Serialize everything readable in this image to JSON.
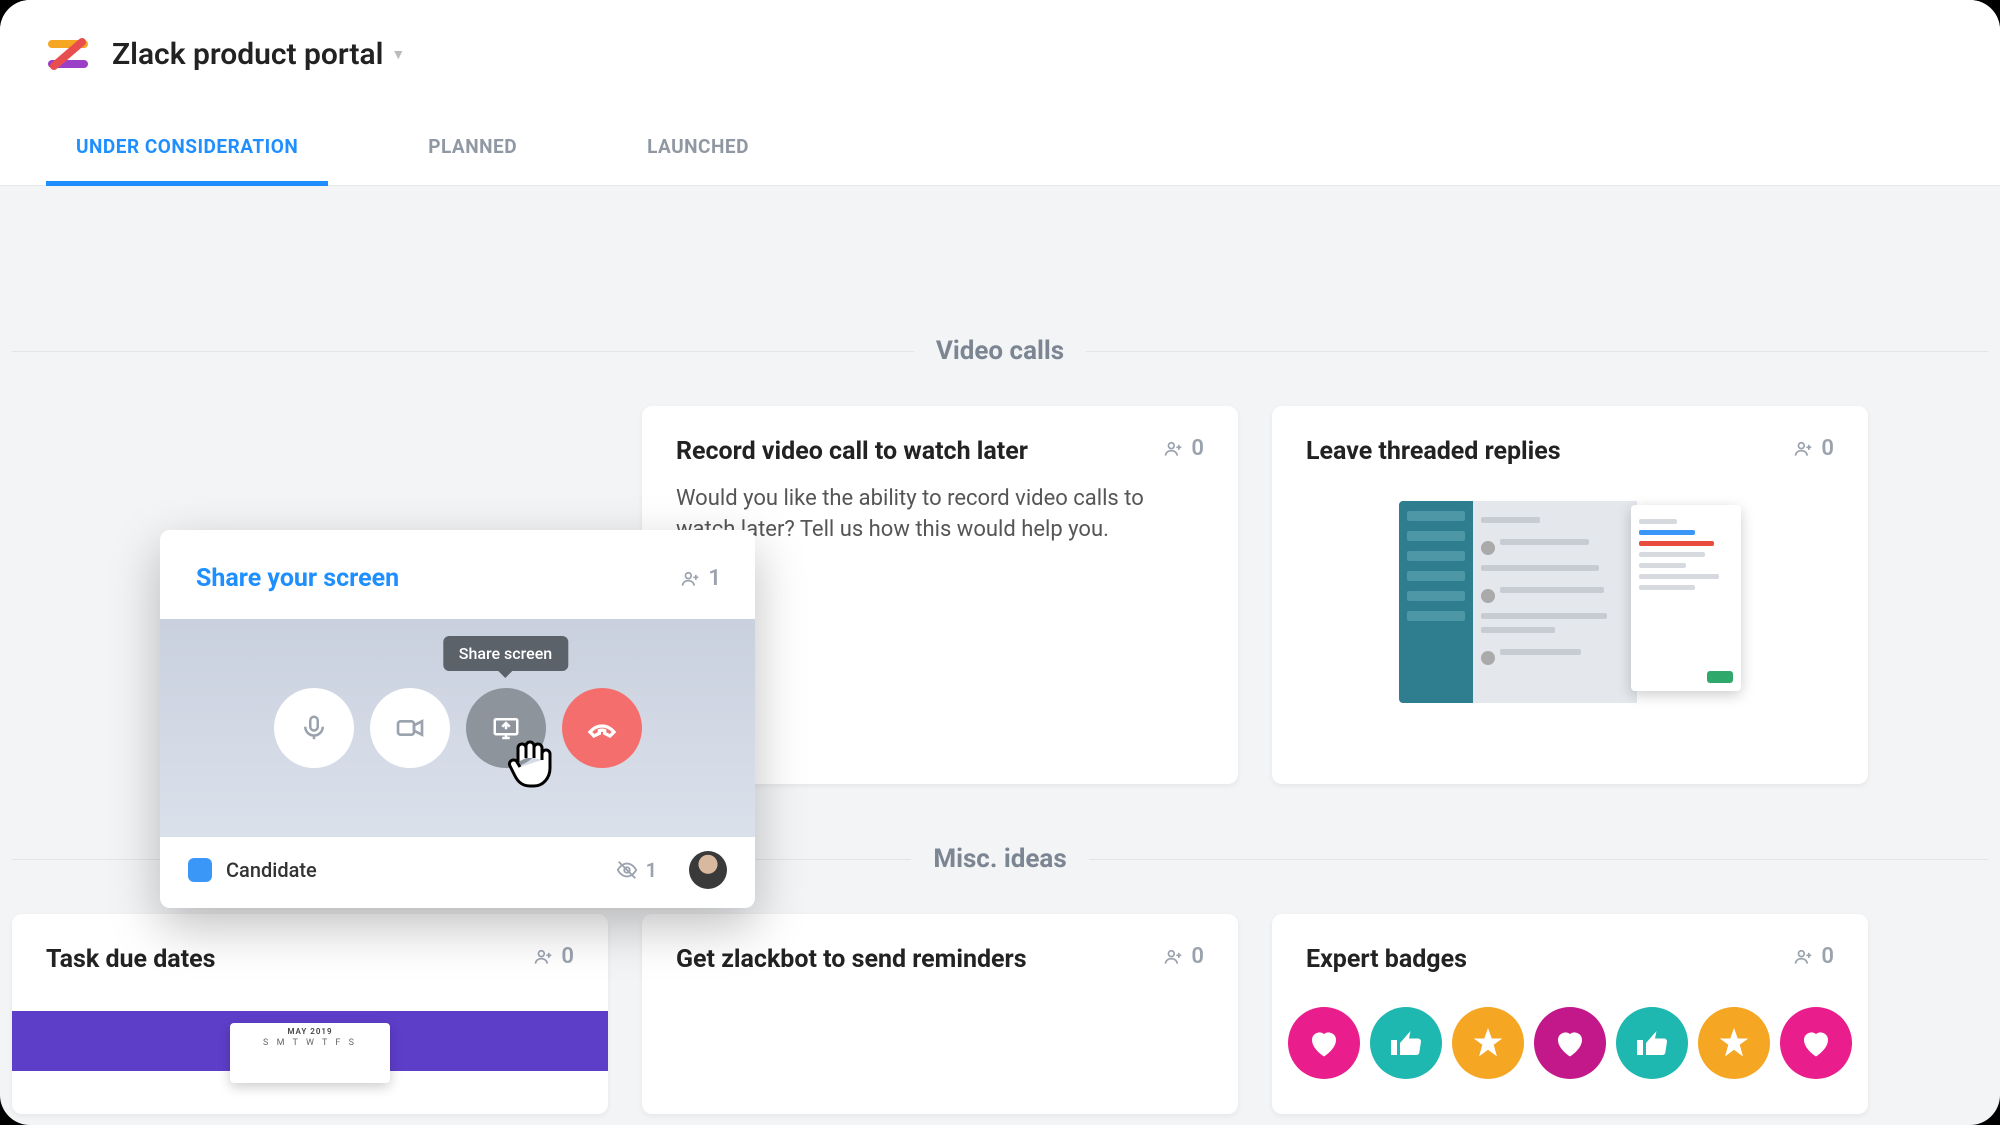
{
  "header": {
    "portal_title": "Zlack product portal"
  },
  "tabs": [
    {
      "label": "UNDER CONSIDERATION",
      "active": true
    },
    {
      "label": "PLANNED",
      "active": false
    },
    {
      "label": "LAUNCHED",
      "active": false
    }
  ],
  "sections": {
    "video_calls": {
      "title": "Video calls",
      "cards": {
        "record": {
          "title": "Record video call to watch later",
          "votes": "0",
          "description": "Would you like the ability to record video calls to watch later? Tell us how this would help you."
        },
        "threaded": {
          "title": "Leave threaded replies",
          "votes": "0"
        }
      }
    },
    "misc": {
      "title": "Misc. ideas",
      "cards": {
        "due_dates": {
          "title": "Task due dates",
          "votes": "0",
          "calendar_month": "MAY 2019",
          "calendar_days": "S M T W T F S"
        },
        "reminders": {
          "title": "Get zlackbot to send reminders",
          "votes": "0"
        },
        "badges": {
          "title": "Expert badges",
          "votes": "0"
        }
      }
    }
  },
  "popup": {
    "title": "Share your screen",
    "votes": "1",
    "tooltip": "Share screen",
    "status_label": "Candidate",
    "view_count": "1"
  },
  "colors": {
    "accent": "#1f8fff",
    "status_candidate": "#3b97f7"
  }
}
